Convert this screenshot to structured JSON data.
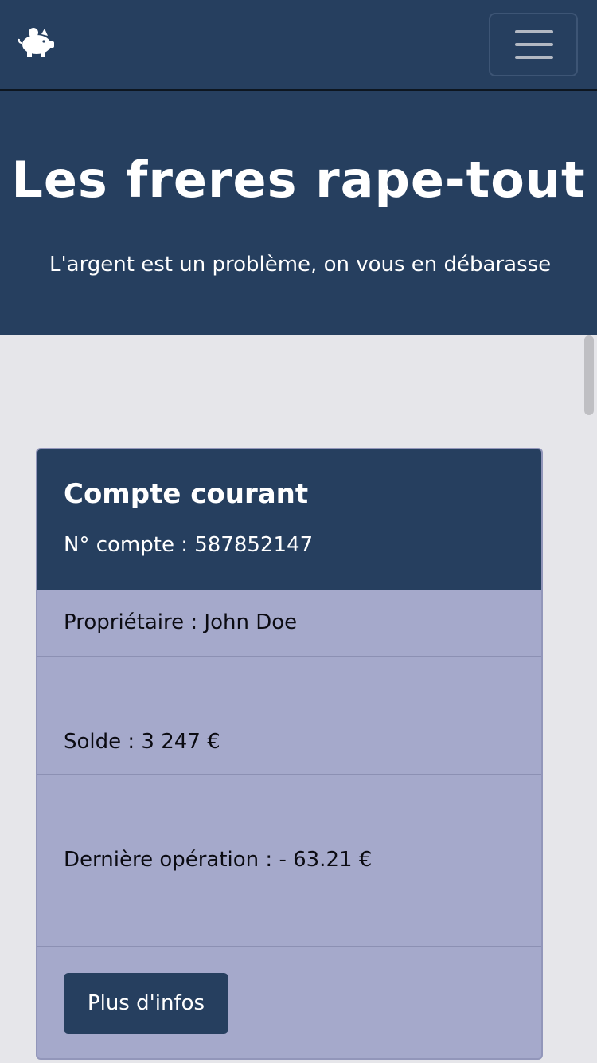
{
  "navbar": {
    "logo_icon": "piggy-bank-icon",
    "menu_icon": "hamburger-menu-icon"
  },
  "hero": {
    "title": "Les freres rape-tout",
    "subtitle": "L'argent est un problème, on vous en débarasse"
  },
  "account_card": {
    "title": "Compte courant",
    "account_number": "N° compte : 587852147",
    "owner": "Propriétaire : John Doe",
    "balance": "Solde : 3 247 €",
    "last_operation": "Dernière opération : - 63.21 €",
    "more_button": "Plus d'infos"
  },
  "colors": {
    "primary": "#263f5f",
    "card_body": "#a5a9cb",
    "page_background": "#e6e6ea"
  }
}
